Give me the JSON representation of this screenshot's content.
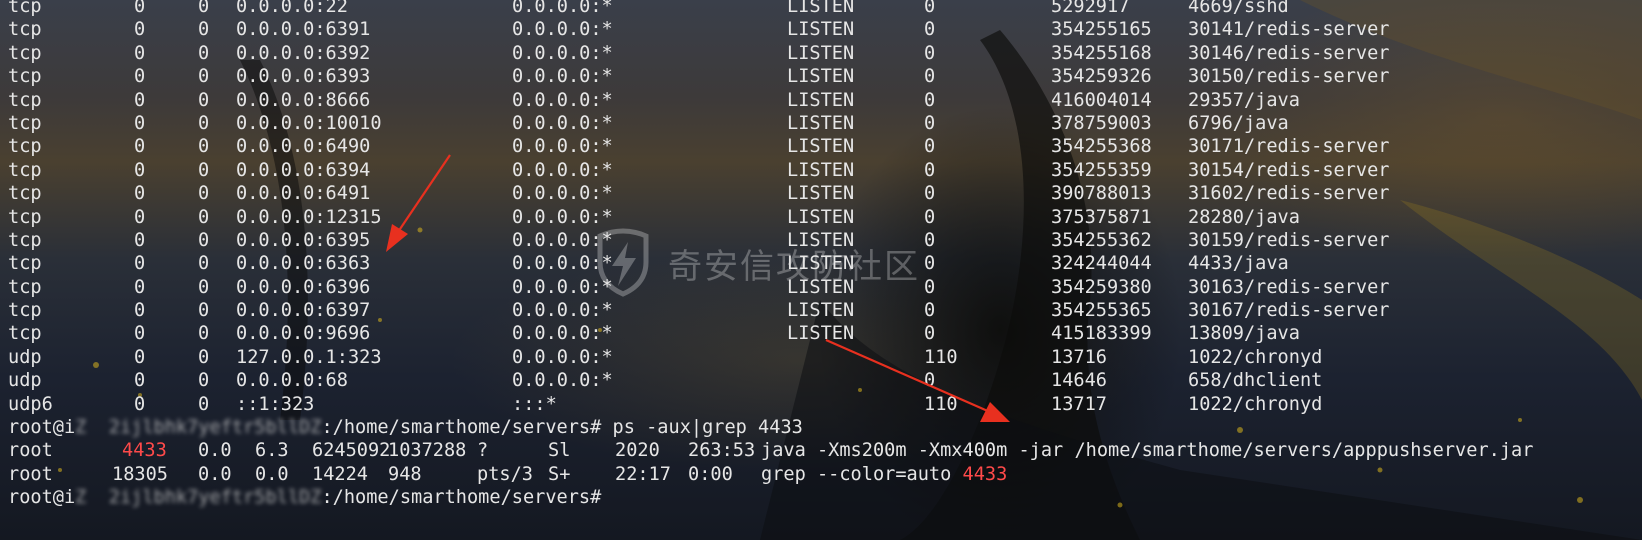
{
  "netstat_rows": [
    {
      "proto": "tcp",
      "recvq": "0",
      "sendq": "0",
      "local": "0.0.0.0:22",
      "foreign": "0.0.0.0:*",
      "state": "LISTEN",
      "user": "0",
      "inode": "5292917",
      "program": "4669/sshd"
    },
    {
      "proto": "tcp",
      "recvq": "0",
      "sendq": "0",
      "local": "0.0.0.0:6391",
      "foreign": "0.0.0.0:*",
      "state": "LISTEN",
      "user": "0",
      "inode": "354255165",
      "program": "30141/redis-server"
    },
    {
      "proto": "tcp",
      "recvq": "0",
      "sendq": "0",
      "local": "0.0.0.0:6392",
      "foreign": "0.0.0.0:*",
      "state": "LISTEN",
      "user": "0",
      "inode": "354255168",
      "program": "30146/redis-server"
    },
    {
      "proto": "tcp",
      "recvq": "0",
      "sendq": "0",
      "local": "0.0.0.0:6393",
      "foreign": "0.0.0.0:*",
      "state": "LISTEN",
      "user": "0",
      "inode": "354259326",
      "program": "30150/redis-server"
    },
    {
      "proto": "tcp",
      "recvq": "0",
      "sendq": "0",
      "local": "0.0.0.0:8666",
      "foreign": "0.0.0.0:*",
      "state": "LISTEN",
      "user": "0",
      "inode": "416004014",
      "program": "29357/java"
    },
    {
      "proto": "tcp",
      "recvq": "0",
      "sendq": "0",
      "local": "0.0.0.0:10010",
      "foreign": "0.0.0.0:*",
      "state": "LISTEN",
      "user": "0",
      "inode": "378759003",
      "program": "6796/java"
    },
    {
      "proto": "tcp",
      "recvq": "0",
      "sendq": "0",
      "local": "0.0.0.0:6490",
      "foreign": "0.0.0.0:*",
      "state": "LISTEN",
      "user": "0",
      "inode": "354255368",
      "program": "30171/redis-server"
    },
    {
      "proto": "tcp",
      "recvq": "0",
      "sendq": "0",
      "local": "0.0.0.0:6394",
      "foreign": "0.0.0.0:*",
      "state": "LISTEN",
      "user": "0",
      "inode": "354255359",
      "program": "30154/redis-server"
    },
    {
      "proto": "tcp",
      "recvq": "0",
      "sendq": "0",
      "local": "0.0.0.0:6491",
      "foreign": "0.0.0.0:*",
      "state": "LISTEN",
      "user": "0",
      "inode": "390788013",
      "program": "31602/redis-server"
    },
    {
      "proto": "tcp",
      "recvq": "0",
      "sendq": "0",
      "local": "0.0.0.0:12315",
      "foreign": "0.0.0.0:*",
      "state": "LISTEN",
      "user": "0",
      "inode": "375375871",
      "program": "28280/java"
    },
    {
      "proto": "tcp",
      "recvq": "0",
      "sendq": "0",
      "local": "0.0.0.0:6395",
      "foreign": "0.0.0.0:*",
      "state": "LISTEN",
      "user": "0",
      "inode": "354255362",
      "program": "30159/redis-server"
    },
    {
      "proto": "tcp",
      "recvq": "0",
      "sendq": "0",
      "local": "0.0.0.0:6363",
      "foreign": "0.0.0.0:*",
      "state": "LISTEN",
      "user": "0",
      "inode": "324244044",
      "program": "4433/java"
    },
    {
      "proto": "tcp",
      "recvq": "0",
      "sendq": "0",
      "local": "0.0.0.0:6396",
      "foreign": "0.0.0.0:*",
      "state": "LISTEN",
      "user": "0",
      "inode": "354259380",
      "program": "30163/redis-server"
    },
    {
      "proto": "tcp",
      "recvq": "0",
      "sendq": "0",
      "local": "0.0.0.0:6397",
      "foreign": "0.0.0.0:*",
      "state": "LISTEN",
      "user": "0",
      "inode": "354255365",
      "program": "30167/redis-server"
    },
    {
      "proto": "tcp",
      "recvq": "0",
      "sendq": "0",
      "local": "0.0.0.0:9696",
      "foreign": "0.0.0.0:*",
      "state": "LISTEN",
      "user": "0",
      "inode": "415183399",
      "program": "13809/java"
    },
    {
      "proto": "udp",
      "recvq": "0",
      "sendq": "0",
      "local": "127.0.0.1:323",
      "foreign": "0.0.0.0:*",
      "state": "",
      "user": "110",
      "inode": "13716",
      "program": "1022/chronyd"
    },
    {
      "proto": "udp",
      "recvq": "0",
      "sendq": "0",
      "local": "0.0.0.0:68",
      "foreign": "0.0.0.0:*",
      "state": "",
      "user": "0",
      "inode": "14646",
      "program": "658/dhclient"
    },
    {
      "proto": "udp6",
      "recvq": "0",
      "sendq": "0",
      "local": "::1:323",
      "foreign": ":::*",
      "state": "",
      "user": "110",
      "inode": "13717",
      "program": "1022/chronyd"
    }
  ],
  "prompt1": {
    "user_host_prefix": "root@i",
    "hidden_host": "Z  2ijlbhk7yeftr5bllDZ",
    "path_suffix": ":/home/smarthome/servers#",
    "command": " ps -aux|grep 4433"
  },
  "ps_rows": [
    {
      "user": "root",
      "pid": "4433",
      "cpu": "0.0",
      "mem": "6.3",
      "vsz": "6245092",
      "rss": "1037288",
      "tty": "?",
      "stat": "Sl",
      "start": "2020",
      "time": "263:53",
      "command": "java -Xms200m -Xmx400m -jar /home/smarthome/servers/apppushserver.jar"
    },
    {
      "user": "root",
      "pid": "18305",
      "cpu": "0.0",
      "mem": "0.0",
      "vsz": "14224",
      "rss": "948",
      "tty": "pts/3",
      "stat": "S+",
      "start": "22:17",
      "time": "0:00",
      "command": "grep --color=auto ",
      "command_match": "4433"
    }
  ],
  "prompt2": {
    "user_host_prefix": "root@i",
    "hidden_host": "Z  2ijlbhk7yeftr5bllDZ",
    "path_suffix": ":/home/smarthome/servers#"
  },
  "watermark": {
    "text": "奇安信攻防社区",
    "icon": "lightning-shield-icon"
  },
  "colors": {
    "text": "#e6e6e6",
    "highlight": "#ff4a4a",
    "arrow": "#e8301f"
  }
}
